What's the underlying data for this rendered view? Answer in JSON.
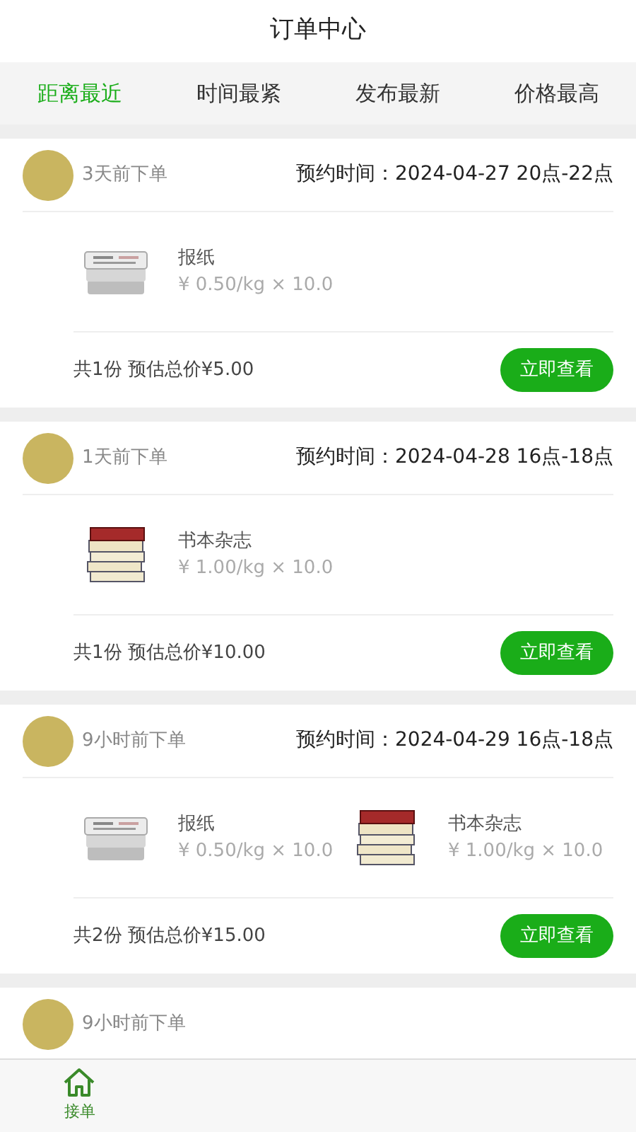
{
  "header": {
    "title": "订单中心"
  },
  "tabs": [
    {
      "label": "距离最近",
      "selected": true
    },
    {
      "label": "时间最紧",
      "selected": false
    },
    {
      "label": "发布最新",
      "selected": false
    },
    {
      "label": "价格最高",
      "selected": false
    }
  ],
  "orders": [
    {
      "time_ago": "3天前下单",
      "appointment": "预约时间：2024-04-27 20点-22点",
      "items": [
        {
          "kind": "newspaper",
          "name": "报纸",
          "price": "¥ 0.50/kg × 10.0"
        }
      ],
      "summary": "共1份 预估总价¥5.00",
      "button": "立即查看"
    },
    {
      "time_ago": "1天前下单",
      "appointment": "预约时间：2024-04-28 16点-18点",
      "items": [
        {
          "kind": "books",
          "name": "书本杂志",
          "price": "¥ 1.00/kg × 10.0"
        }
      ],
      "summary": "共1份 预估总价¥10.00",
      "button": "立即查看"
    },
    {
      "time_ago": "9小时前下单",
      "appointment": "预约时间：2024-04-29 16点-18点",
      "items": [
        {
          "kind": "newspaper",
          "name": "报纸",
          "price": "¥ 0.50/kg × 10.0"
        },
        {
          "kind": "books",
          "name": "书本杂志",
          "price": "¥ 1.00/kg × 10.0"
        }
      ],
      "summary": "共2份 预估总价¥15.00",
      "button": "立即查看"
    },
    {
      "time_ago": "9小时前下单"
    }
  ],
  "bottom_nav": [
    {
      "label": "接单",
      "selected": true
    }
  ]
}
